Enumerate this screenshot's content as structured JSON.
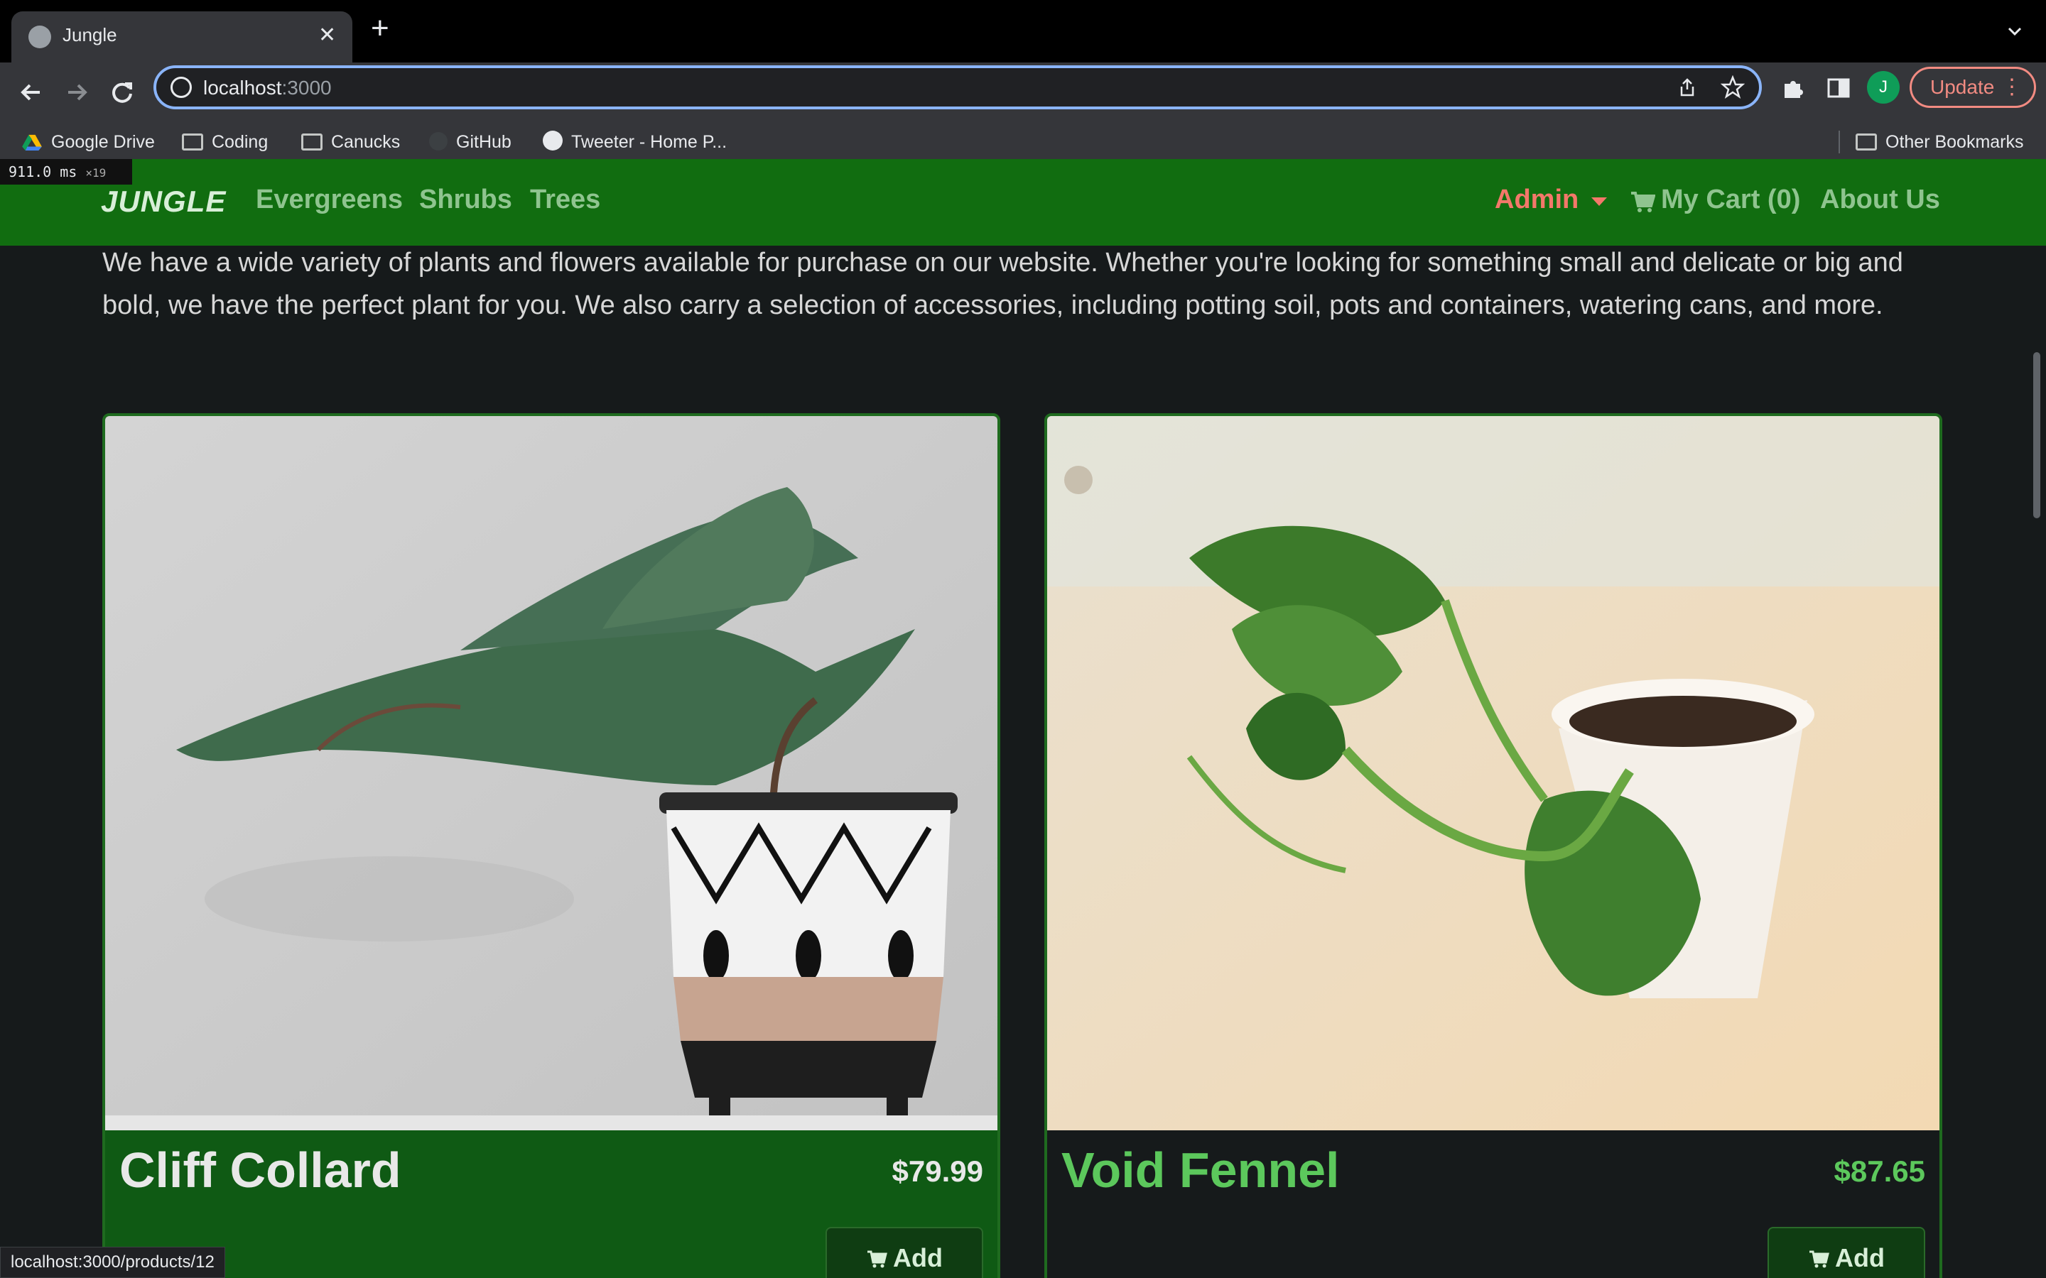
{
  "browser": {
    "tab_title": "Jungle",
    "url_host": "localhost",
    "url_port": ":3000",
    "update_label": "Update",
    "avatar_letter": "J",
    "bookmarks": [
      "Google Drive",
      "Coding",
      "Canucks",
      "GitHub",
      "Tweeter - Home P..."
    ],
    "other_bookmarks": "Other Bookmarks",
    "status_url": "localhost:3000/products/12"
  },
  "perf_overlay": {
    "time": "911.0",
    "unit": "ms",
    "count": "×19"
  },
  "nav": {
    "brand": "JUNGLE",
    "links": [
      "Evergreens",
      "Shrubs",
      "Trees"
    ],
    "admin": "Admin",
    "cart": "My Cart (0)",
    "about": "About Us"
  },
  "intro": "We have a wide variety of plants and flowers available for purchase on our website. Whether you're looking for something small and delicate or big and bold, we have the perfect plant for you. We also carry a selection of accessories, including potting soil, pots and containers, watering cans, and more.",
  "products": [
    {
      "name": "Cliff Collard",
      "price": "$79.99",
      "add_label": "Add",
      "name_color": "#e8e8e8",
      "price_color": "#e8e8e8",
      "footer_color": "#0f5a14"
    },
    {
      "name": "Void Fennel",
      "price": "$87.65",
      "add_label": "Add",
      "name_color": "#5cc85c",
      "price_color": "#5cc85c",
      "footer_color": "#161a1b"
    }
  ],
  "colors": {
    "navbar": "#116d10",
    "admin": "#f4786a",
    "nav_link": "#8fc48f",
    "page_bg": "#161a1b"
  }
}
